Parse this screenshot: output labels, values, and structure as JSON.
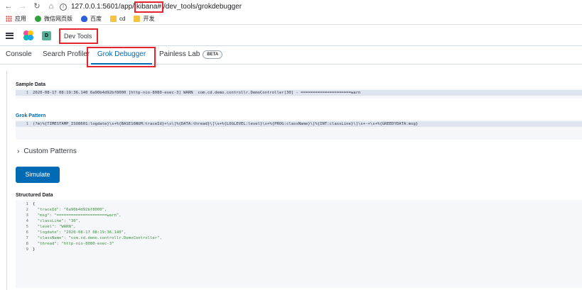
{
  "browser": {
    "url_prefix": "127.0.0.1:5601/app/",
    "url_highlight": "kibana#",
    "url_suffix": "/dev_tools/grokdebugger",
    "bookmarks": [
      {
        "label": "应用",
        "icon": "apps-icon"
      },
      {
        "label": "微信网页版",
        "icon": "wechat-icon"
      },
      {
        "label": "百度",
        "icon": "baidu-icon"
      },
      {
        "label": "cd",
        "icon": "folder-icon"
      },
      {
        "label": "开发",
        "icon": "folder-icon"
      }
    ]
  },
  "header": {
    "space_initial": "D",
    "breadcrumb": "Dev Tools"
  },
  "tabs": [
    {
      "label": "Console"
    },
    {
      "label": "Search Profiler"
    },
    {
      "label": "Grok Debugger"
    },
    {
      "label": "Painless Lab",
      "badge": "BETA"
    }
  ],
  "sample_data": {
    "label": "Sample Data",
    "lines": [
      "2020-08-17 08:19:36.140 6a90b4d92bf8000 [http-nio-8080-exec-3] WARN  com.cd.demo.controllr.DemoController[30] - =====================warn"
    ]
  },
  "grok_pattern": {
    "label": "Grok Pattern",
    "lines": [
      "(?m)%{TIMESTAMP_ISO8601:logdate}\\s+%{BASE16NUM:traceId}+\\s\\[%{DATA:thread}\\]\\s+%{LOGLEVEL:level}\\s+%{PROG:className}\\[%{INT:classLine}\\]\\s+-+\\s+%{GREEDYDATA:msg}"
    ]
  },
  "custom_patterns": {
    "label": "Custom Patterns"
  },
  "simulate_button": "Simulate",
  "structured_data": {
    "label": "Structured Data",
    "lines": [
      "{",
      "  \"traceId\": \"6a90b4d92bf8000\",",
      "  \"msg\": \"=====================warn\",",
      "  \"classLine\": \"30\",",
      "  \"level\": \"WARN\",",
      "  \"logdate\": \"2020-08-17 08:19:36.140\",",
      "  \"className\": \"com.cd.demo.controllr.DemoController\",",
      "  \"thread\": \"http-nio-8080-exec-3\"",
      "}"
    ],
    "line_numbers": [
      "1",
      "2",
      "3",
      "4",
      "5",
      "6",
      "7",
      "8",
      "9"
    ]
  }
}
